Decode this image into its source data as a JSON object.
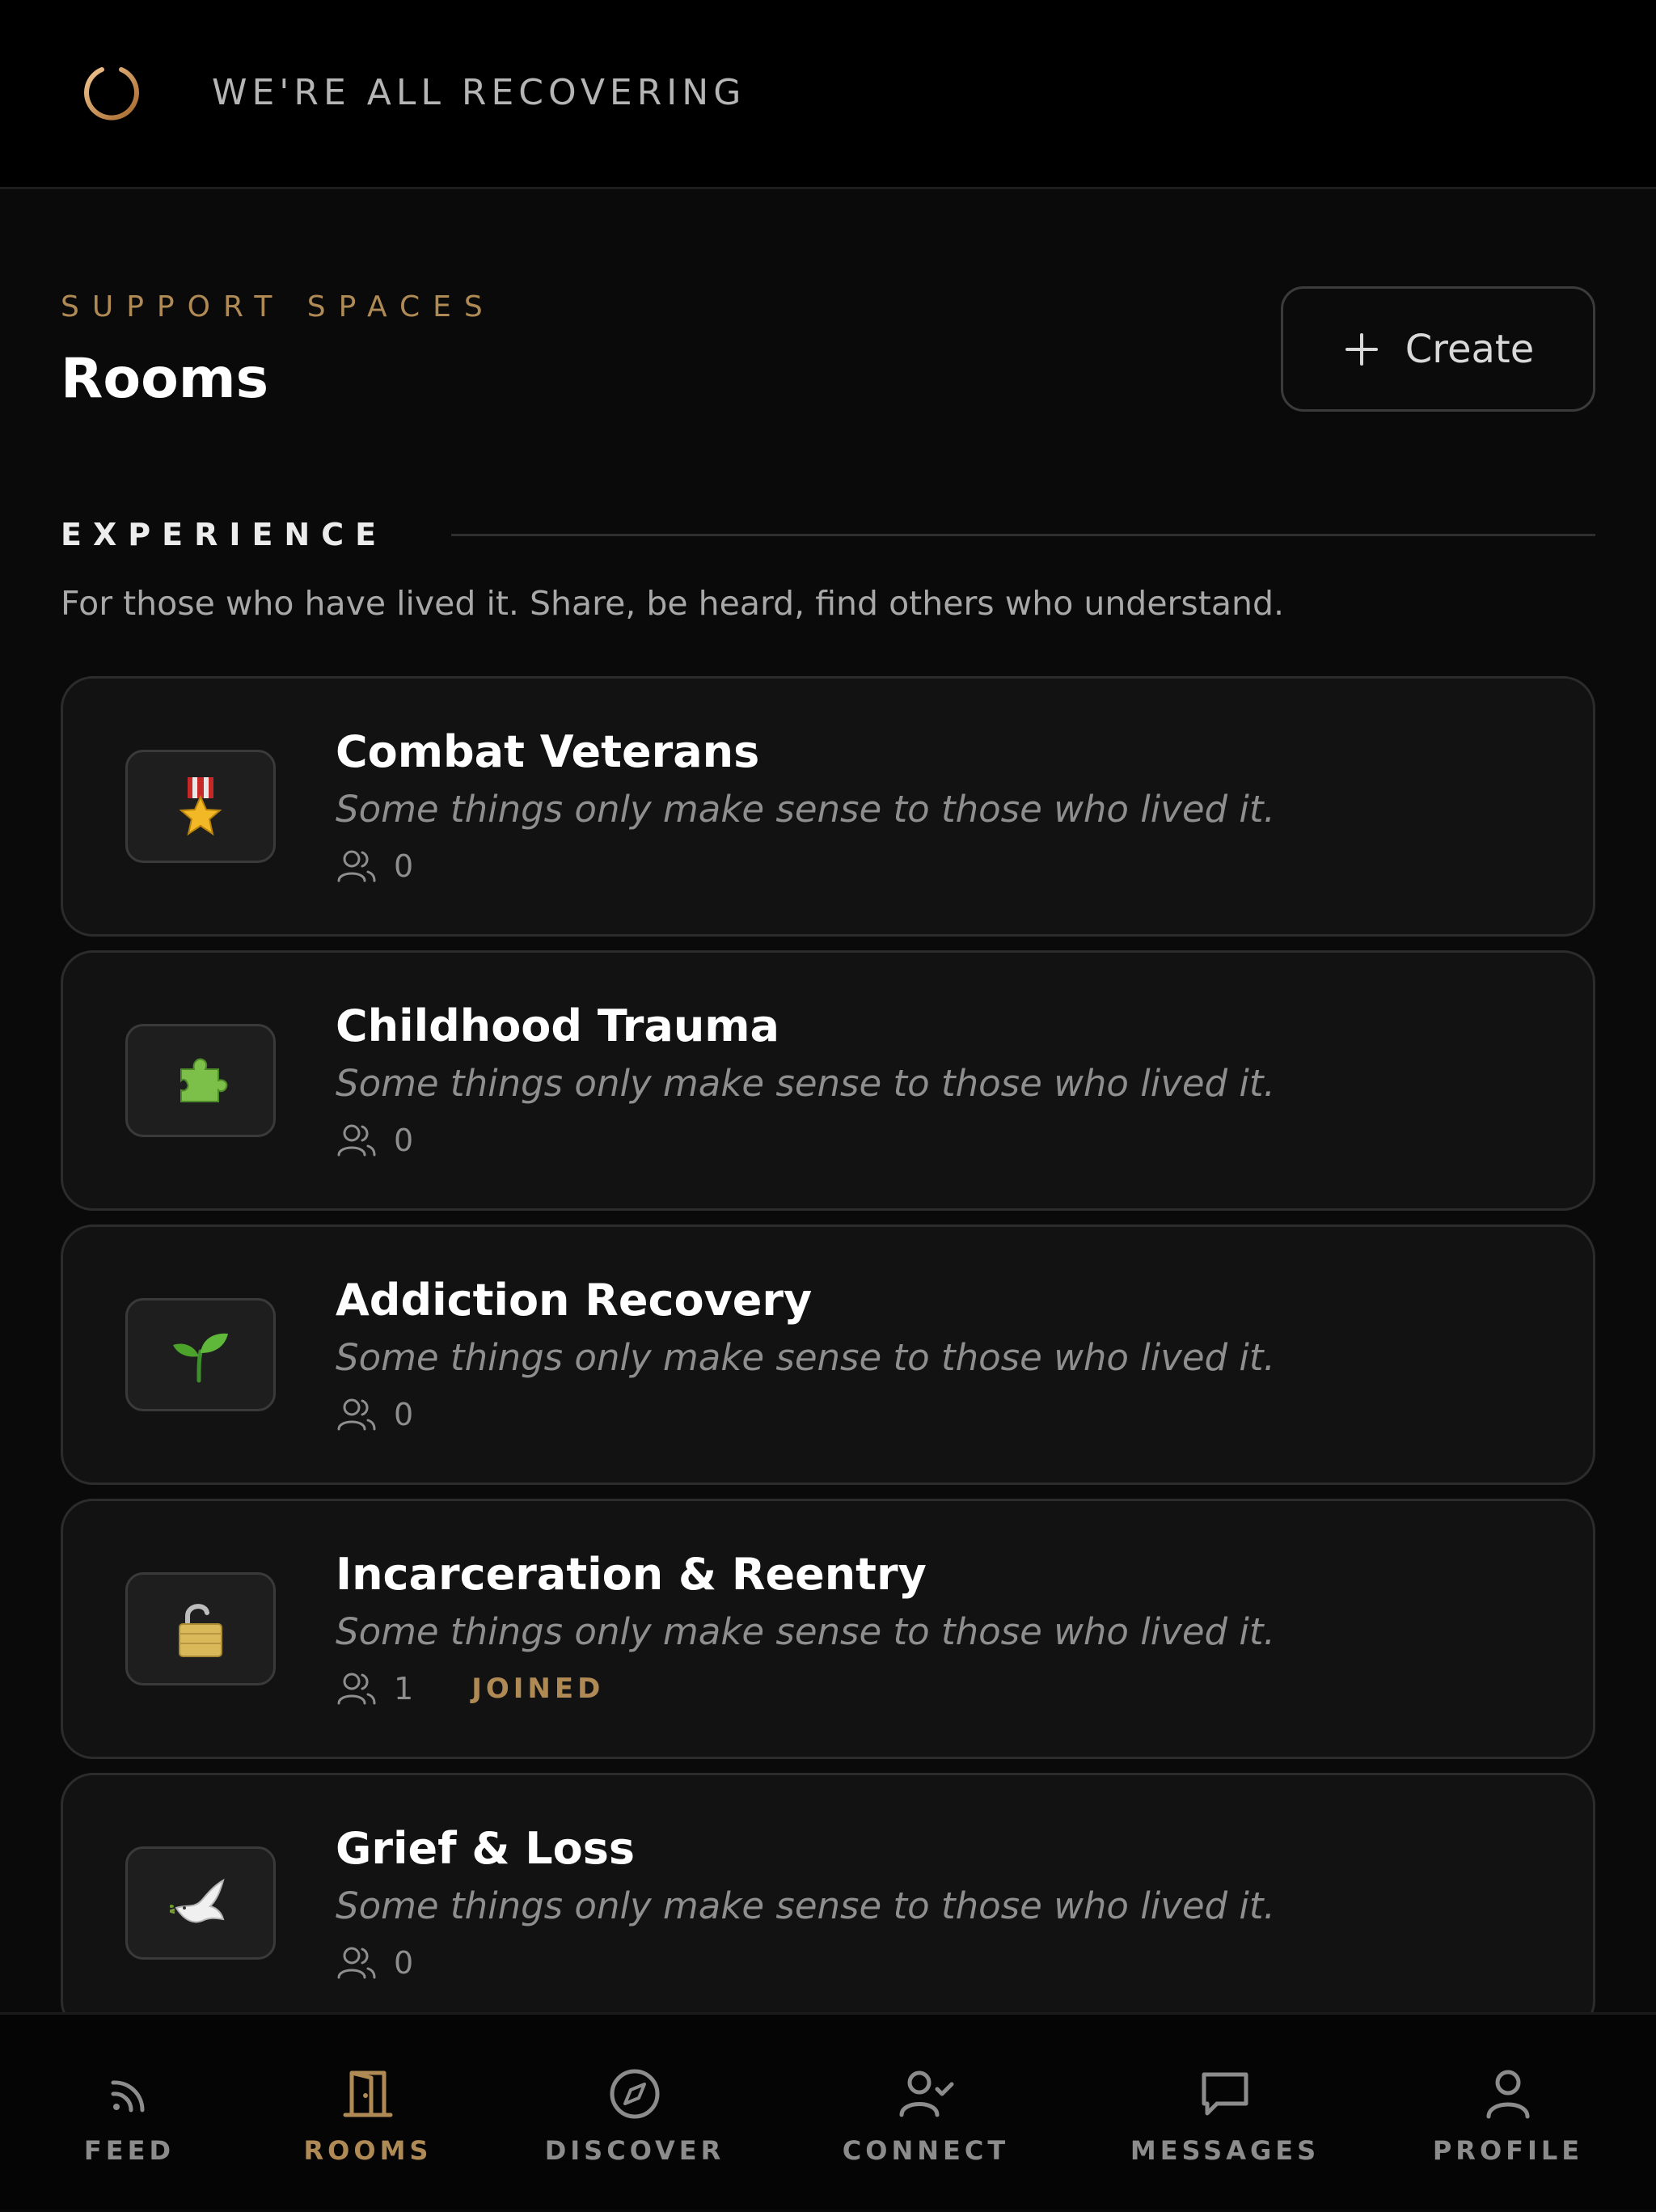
{
  "header": {
    "app_title": "WE'RE ALL RECOVERING"
  },
  "page": {
    "eyebrow": "SUPPORT SPACES",
    "title": "Rooms",
    "create_label": "Create"
  },
  "section": {
    "title": "EXPERIENCE",
    "description": "For those who have lived it. Share, be heard, find others who understand."
  },
  "rooms": [
    {
      "name": "Combat Veterans",
      "icon": "military-medal-icon",
      "tagline": "Some things only make sense to those who lived it.",
      "members": "0",
      "badge": ""
    },
    {
      "name": "Childhood Trauma",
      "icon": "puzzle-piece-icon",
      "tagline": "Some things only make sense to those who lived it.",
      "members": "0",
      "badge": ""
    },
    {
      "name": "Addiction Recovery",
      "icon": "seedling-icon",
      "tagline": "Some things only make sense to those who lived it.",
      "members": "0",
      "badge": ""
    },
    {
      "name": "Incarceration & Reentry",
      "icon": "open-padlock-icon",
      "tagline": "Some things only make sense to those who lived it.",
      "members": "1",
      "badge": "JOINED"
    },
    {
      "name": "Grief & Loss",
      "icon": "dove-icon",
      "tagline": "Some things only make sense to those who lived it.",
      "members": "0",
      "badge": ""
    }
  ],
  "nav": {
    "items": [
      {
        "label": "FEED",
        "icon": "feed-icon",
        "active": false
      },
      {
        "label": "ROOMS",
        "icon": "door-icon",
        "active": true
      },
      {
        "label": "DISCOVER",
        "icon": "compass-icon",
        "active": false
      },
      {
        "label": "CONNECT",
        "icon": "user-check-icon",
        "active": false
      },
      {
        "label": "MESSAGES",
        "icon": "message-icon",
        "active": false
      },
      {
        "label": "PROFILE",
        "icon": "user-icon",
        "active": false
      }
    ]
  },
  "colors": {
    "accent": "#b08a55",
    "background": "#0a0a0a",
    "card": "#121212",
    "muted_text": "#8e8e8e"
  }
}
